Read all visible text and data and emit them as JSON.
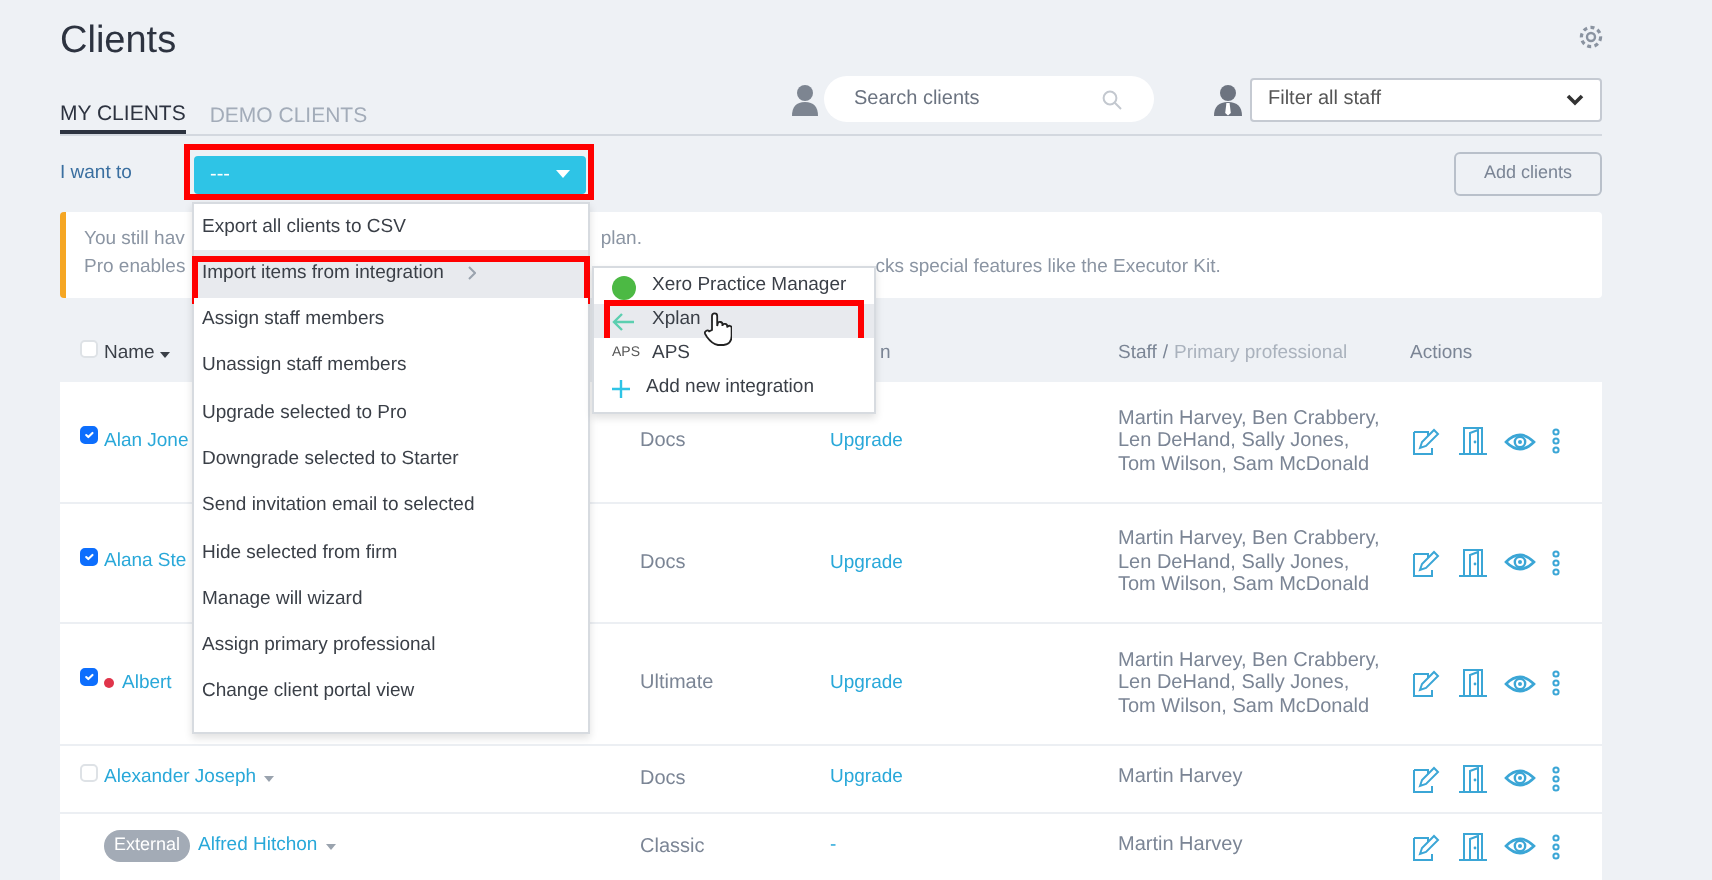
{
  "page": {
    "title": "Clients"
  },
  "tabs": [
    {
      "label": "MY CLIENTS",
      "selected": true
    },
    {
      "label": "DEMO CLIENTS",
      "selected": false
    }
  ],
  "search": {
    "placeholder": "Search clients"
  },
  "staff_filter": {
    "value": "Filter all staff"
  },
  "action_bar": {
    "label": "I want to",
    "select_value": "---",
    "highlighted": true,
    "add_button": "Add clients"
  },
  "notice": {
    "lines": [
      [
        "You still hav",
        "plan."
      ],
      [
        "Pro enables",
        "cks special features like the Executor Kit."
      ]
    ]
  },
  "action_menu": {
    "items": [
      {
        "label": "Export all clients to CSV",
        "selected": false,
        "has_submenu": false,
        "highlighted": false
      },
      {
        "label": "Import items from integration",
        "selected": true,
        "has_submenu": true,
        "highlighted": true
      },
      {
        "label": "Assign staff members",
        "selected": false,
        "has_submenu": false,
        "highlighted": false
      },
      {
        "label": "Unassign staff members",
        "selected": false,
        "has_submenu": false,
        "highlighted": false
      },
      {
        "label": "Upgrade selected to Pro",
        "selected": false,
        "has_submenu": false,
        "highlighted": false
      },
      {
        "label": "Downgrade selected to Starter",
        "selected": false,
        "has_submenu": false,
        "highlighted": false
      },
      {
        "label": "Send invitation email to selected",
        "selected": false,
        "has_submenu": false,
        "highlighted": false
      },
      {
        "label": "Hide selected from firm",
        "selected": false,
        "has_submenu": false,
        "highlighted": false
      },
      {
        "label": "Manage will wizard",
        "selected": false,
        "has_submenu": false,
        "highlighted": false
      },
      {
        "label": "Assign primary professional",
        "selected": false,
        "has_submenu": false,
        "highlighted": false
      },
      {
        "label": "Change client portal view",
        "selected": false,
        "has_submenu": false,
        "highlighted": false
      }
    ]
  },
  "integration_menu": {
    "items": [
      {
        "kind": "xero",
        "label": "Xero Practice Manager",
        "selected": false,
        "highlighted": false
      },
      {
        "kind": "xplan",
        "label": "Xplan",
        "selected": true,
        "highlighted": true
      },
      {
        "kind": "aps",
        "logo_text": "APS",
        "label": "APS",
        "selected": false,
        "highlighted": false
      },
      {
        "kind": "add",
        "label": "Add new integration",
        "selected": false,
        "highlighted": false
      }
    ]
  },
  "table": {
    "header_checked": false,
    "columns": [
      {
        "label": "Name"
      },
      {
        "label": "n"
      },
      {
        "label": "Staff",
        "separator": "/",
        "sublabel": "Primary professional"
      },
      {
        "label": "Actions"
      }
    ],
    "rows": [
      {
        "kind": "client",
        "checked": true,
        "flagged": false,
        "name": "Alan Jone",
        "dropdown": false,
        "plan": "Docs",
        "upgrade": "Upgrade",
        "staff": "Martin Harvey, Ben Crabbery, Len DeHand, Sally Jones, Tom Wilson, Sam McDonald"
      },
      {
        "kind": "client",
        "checked": true,
        "flagged": false,
        "name": "Alana Ste",
        "dropdown": false,
        "plan": "Docs",
        "upgrade": "Upgrade",
        "staff": "Martin Harvey, Ben Crabbery, Len DeHand, Sally Jones, Tom Wilson, Sam McDonald"
      },
      {
        "kind": "client",
        "checked": true,
        "flagged": true,
        "name": "Albert",
        "dropdown": false,
        "plan": "Ultimate",
        "upgrade": "Upgrade",
        "staff": "Martin Harvey, Ben Crabbery, Len DeHand, Sally Jones, Tom Wilson, Sam McDonald"
      },
      {
        "kind": "client",
        "checked": false,
        "flagged": false,
        "name": "Alexander Joseph",
        "dropdown": true,
        "plan": "Docs",
        "upgrade": "Upgrade",
        "staff": "Martin Harvey"
      },
      {
        "kind": "external",
        "badge": "External",
        "name": "Alfred Hitchon",
        "dropdown": true,
        "plan": "Classic",
        "upgrade": "-",
        "staff": "Martin Harvey"
      }
    ]
  }
}
